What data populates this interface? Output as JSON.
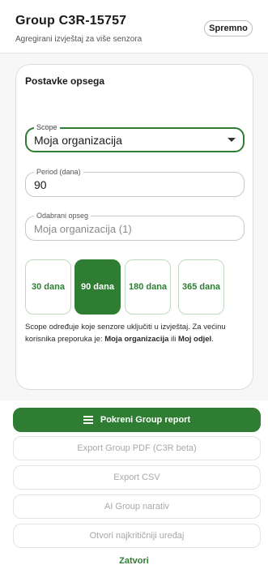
{
  "header": {
    "title": "Group C3R-15757",
    "subtitle": "Agregirani izvještaj za više senzora",
    "status_badge": "Spremno"
  },
  "card": {
    "title": "Postavke opsega",
    "scope": {
      "label": "Scope",
      "value": "Moja organizacija"
    },
    "period": {
      "label": "Period (dana)",
      "value": "90"
    },
    "selected_scope": {
      "label": "Odabrani opseg",
      "value": "Moja organizacija (1)"
    },
    "day_options": [
      {
        "label": "30 dana",
        "selected": false
      },
      {
        "label": "90 dana",
        "selected": true
      },
      {
        "label": "180 dana",
        "selected": false
      },
      {
        "label": "365 dana",
        "selected": false
      }
    ],
    "help": {
      "text": "Scope određuje koje senzore uključiti u izvještaj. Za većinu korisnika preporuka je: ",
      "rec1": "Moja organizacija",
      "or": " ili ",
      "rec2": "Moj odjel",
      "end": "."
    }
  },
  "actions": {
    "run": {
      "label": "Pokreni Group report",
      "icon": "list-icon"
    },
    "export_pdf": "Export Group PDF (C3R beta)",
    "export_csv": "Export CSV",
    "ai_narrative": "AI Group narativ",
    "open_critical": "Otvori najkritičniji uređaj",
    "close": "Zatvori"
  },
  "colors": {
    "accent": "#2e7d32",
    "disabled_text": "#a8a8a8"
  }
}
